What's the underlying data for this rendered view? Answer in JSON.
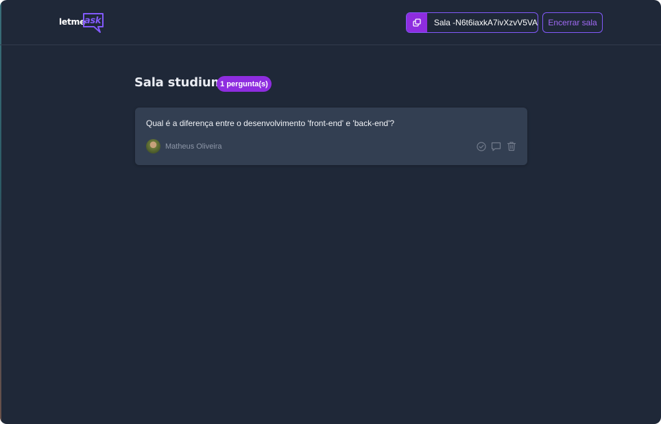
{
  "logo": {
    "part_a": "letme",
    "part_b": "ask"
  },
  "header": {
    "room_code": "Sala -N6t6iaxkA7ivXzvV5VA",
    "room_code_icon": "copy-icon",
    "close_room_label": "Encerrar sala"
  },
  "room": {
    "title": "Sala studium",
    "question_count_badge": "1 pergunta(s)"
  },
  "questions": [
    {
      "text": "Qual é a diferença entre o desenvolvimento 'front-end' e 'back-end'?",
      "author": "Matheus Oliveira",
      "actions": [
        "check-circle-icon",
        "answer-bubble-icon",
        "trash-icon"
      ]
    }
  ],
  "colors": {
    "background": "#1f2838",
    "card": "#333f52",
    "accent": "#835afd",
    "accent_strong": "#8e2ddf"
  }
}
